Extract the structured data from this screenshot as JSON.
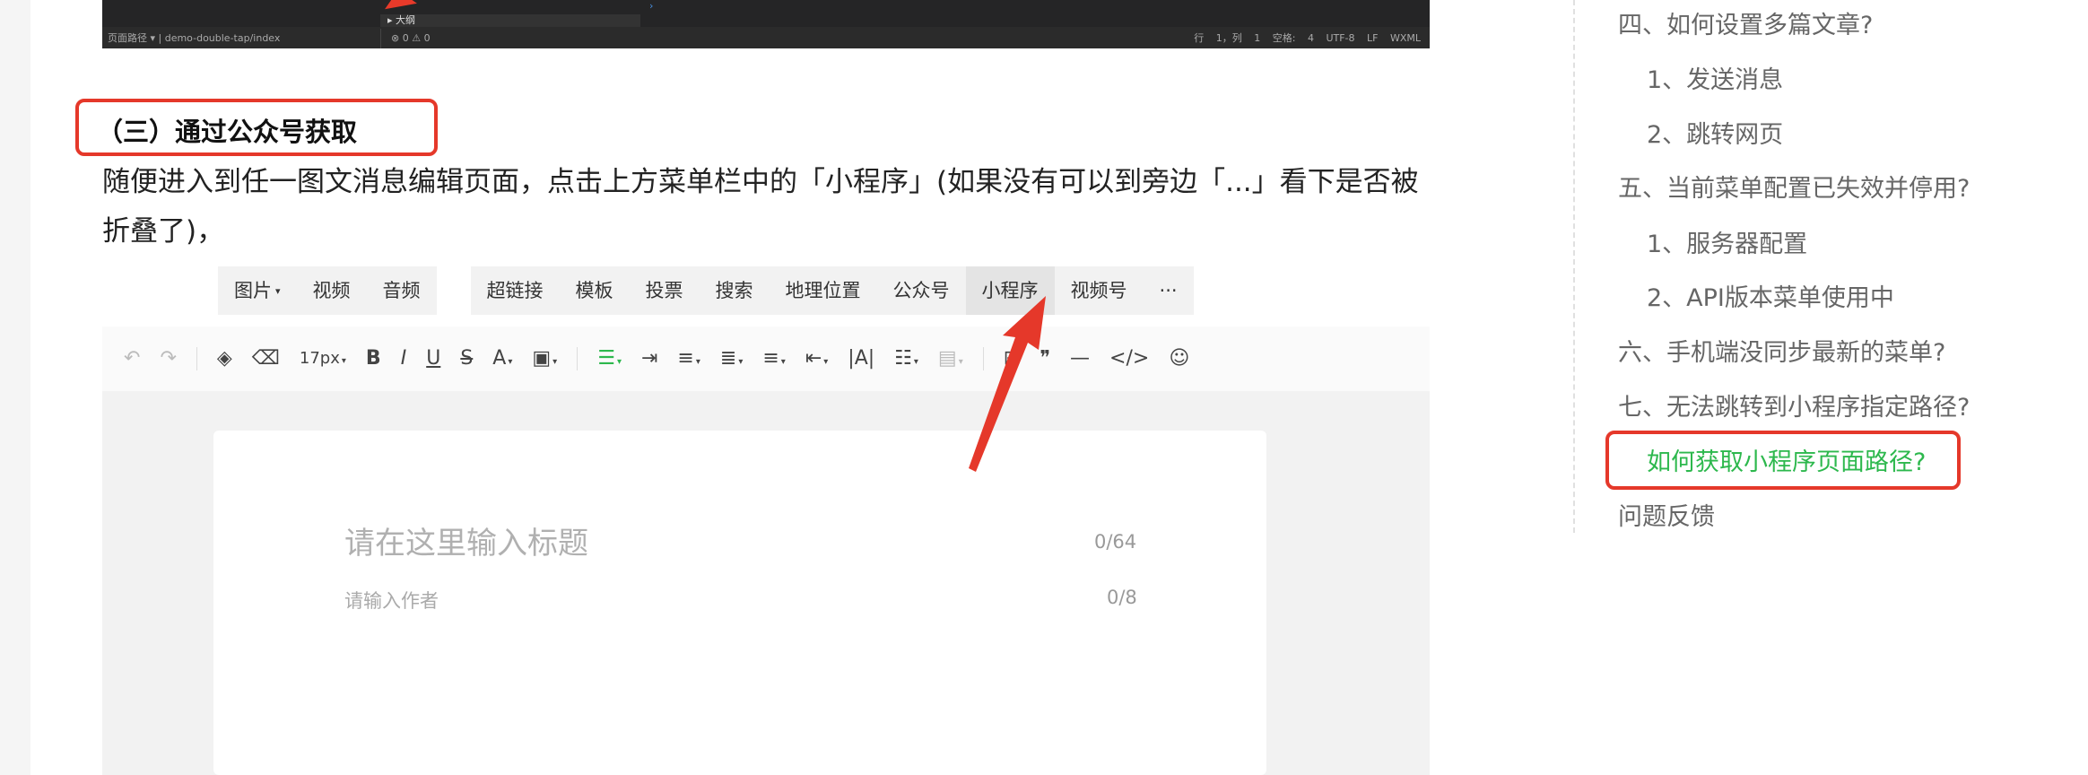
{
  "ide": {
    "outline_label": "大纲",
    "status_left": "页面路径 ▾  |  demo-double-tap/index",
    "status_mid": "⊗ 0 ⚠ 0",
    "status_right": "行 1，列 1  空格: 4  UTF-8  LF  WXML"
  },
  "article": {
    "heading": "（三）通过公众号获取",
    "paragraph": "随便进入到任一图文消息编辑页面，点击上方菜单栏中的「小程序」(如果没有可以到旁边「...」看下是否被折叠了)，"
  },
  "menu": {
    "group1": [
      "图片",
      "视频",
      "音频"
    ],
    "group2": [
      "超链接",
      "模板",
      "投票",
      "搜索",
      "地理位置",
      "公众号",
      "小程序",
      "视频号",
      "···"
    ],
    "active": "小程序"
  },
  "toolbar": {
    "font_size": "17px"
  },
  "editor": {
    "title_placeholder": "请在这里输入标题",
    "title_count": "0/64",
    "author_placeholder": "请输入作者",
    "author_count": "0/8"
  },
  "toc": {
    "items": [
      {
        "label": "四、如何设置多篇文章?"
      },
      {
        "label": "1、发送消息"
      },
      {
        "label": "2、跳转网页"
      },
      {
        "label": "五、当前菜单配置已失效并停用?"
      },
      {
        "label": "1、服务器配置"
      },
      {
        "label": "2、API版本菜单使用中"
      },
      {
        "label": "六、手机端没同步最新的菜单?"
      },
      {
        "label": "七、无法跳转到小程序指定路径?"
      },
      {
        "label": "如何获取小程序页面路径?"
      },
      {
        "label": "问题反馈"
      }
    ]
  },
  "colors": {
    "accent_green": "#2db84d",
    "highlight_red": "#e5382a"
  }
}
